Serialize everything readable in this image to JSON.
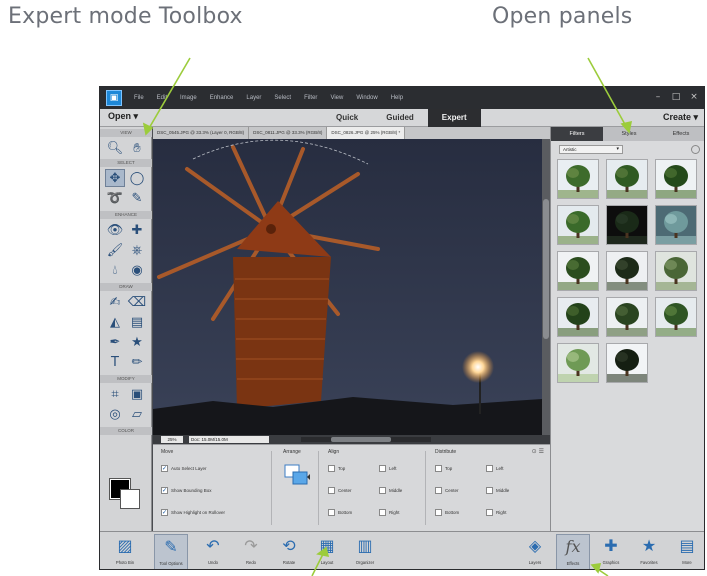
{
  "callouts": {
    "toolbox": "Expert mode Toolbox",
    "panels": "Open panels"
  },
  "app": {
    "menu": [
      "File",
      "Edit",
      "Image",
      "Enhance",
      "Layer",
      "Select",
      "Filter",
      "View",
      "Window",
      "Help"
    ],
    "window_controls": [
      "–",
      "□",
      "×"
    ]
  },
  "modebar": {
    "open_label": "Open",
    "tabs": [
      "Quick",
      "Guided",
      "Expert"
    ],
    "active_tab": "Expert",
    "create_label": "Create"
  },
  "toolbox": {
    "sections": [
      "VIEW",
      "SELECT",
      "ENHANCE",
      "DRAW",
      "MODIFY",
      "COLOR"
    ]
  },
  "doc_tabs": [
    "DSC_0545.JPG @ 33.3% (Layer 0, RGB/8)",
    "DSC_0811.JPG @ 33.3% (RGB/8)",
    "DSC_0826.JPG @ 25% (RGB/8) *"
  ],
  "canvas_status": {
    "zoom": "25%",
    "doc_info": "Doc: 15.0M/15.0M"
  },
  "tool_options": {
    "move_title": "Move",
    "move_options": [
      "Auto Select Layer",
      "Show Bounding Box",
      "Show Highlight on Rollover"
    ],
    "arrange_title": "Arrange",
    "align_title": "Align",
    "align_options": [
      "Top",
      "Left",
      "Center",
      "Middle",
      "Bottom",
      "Right"
    ],
    "distribute_title": "Distribute",
    "distribute_options": [
      "Top",
      "Left",
      "Center",
      "Middle",
      "Bottom",
      "Right"
    ]
  },
  "panel_bin": {
    "tabs": [
      "Filters",
      "Styles",
      "Effects"
    ],
    "active_tab": "Filters",
    "dropdown_value": "Artistic"
  },
  "taskbar": {
    "left": [
      "Photo Bin",
      "Tool Options",
      "Undo",
      "Redo",
      "Rotate",
      "Layout",
      "Organizer"
    ],
    "right": [
      "Layers",
      "Effects",
      "Graphics",
      "Favorites",
      "More"
    ]
  },
  "colors": {
    "accent_blue": "#1e88d8",
    "callout_arrow": "#9ccc3c",
    "canvas_sky": "#2d3346"
  }
}
